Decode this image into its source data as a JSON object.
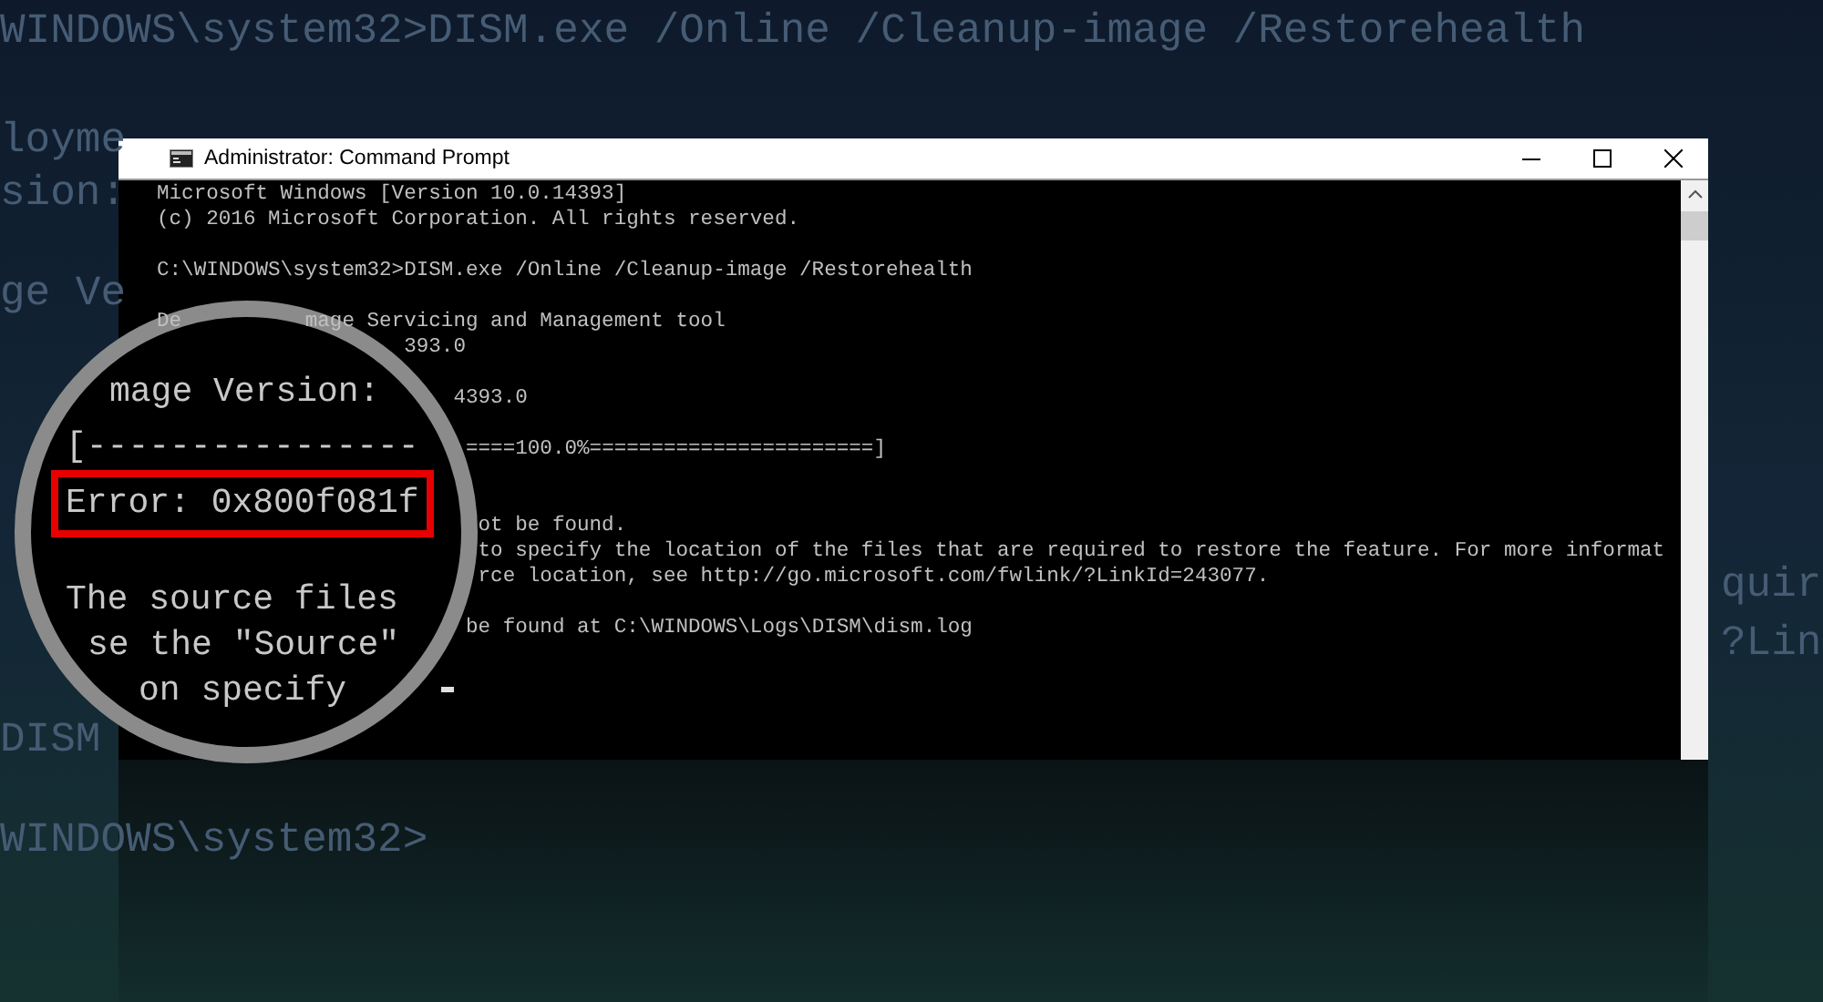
{
  "background_text": [
    "WINDOWS\\system32>DISM.exe /Online /Cleanup-image /Restorehealth",
    "loyme",
    "sion:",
    "ge Ve",
    "DISM",
    "WINDOWS\\system32>",
    "quir",
    "?Lin"
  ],
  "window": {
    "title": "Administrator: Command Prompt"
  },
  "console": {
    "fragments": [
      "Microsoft Windows [Version 10.0.14393]",
      "(c) 2016 Microsoft Corporation. All rights reserved.",
      "C:\\WINDOWS\\system32>DISM.exe /Online /Cleanup-image /Restorehealth",
      "De",
      "mage Servicing and Management tool",
      "393.0",
      "4393.0",
      "====100.0%=======================]",
      "ot be found.",
      "to specify the location of the files that are required to restore the feature. For more informat",
      "rce location, see http://go.microsoft.com/fwlink/?LinkId=243077.",
      "be found at C:\\WINDOWS\\Logs\\DISM\\dism.log"
    ]
  },
  "magnifier": {
    "lines": [
      {
        "text": "mage Version:",
        "kind": "plain"
      },
      {
        "text": "[----------------",
        "kind": "plain"
      },
      {
        "text": "Error: 0x800f081f",
        "kind": "highlighted"
      },
      {
        "text": "The source files",
        "kind": "plain"
      },
      {
        "text": "se the \"Source\"",
        "kind": "plain"
      },
      {
        "text": "on specify",
        "kind": "plain"
      }
    ]
  }
}
